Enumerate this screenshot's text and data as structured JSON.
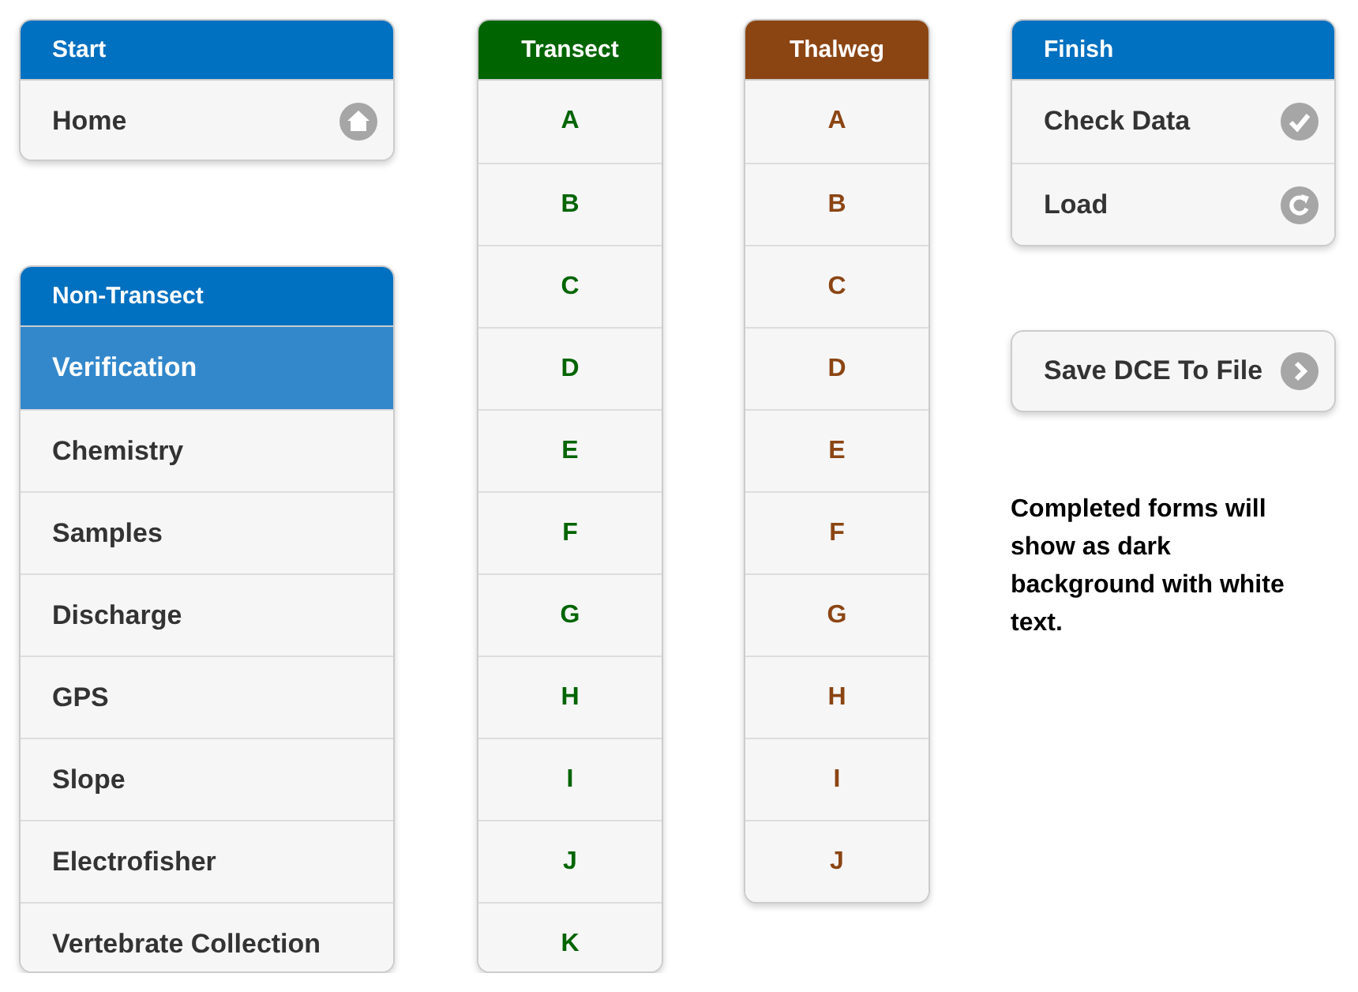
{
  "columns": [
    {
      "panels": [
        {
          "title": "Start",
          "color": "#0070c0",
          "kind": "nav",
          "items": [
            {
              "label": "Home",
              "kind": "home",
              "selected": false
            }
          ]
        },
        {
          "title": "Non-Transect",
          "color": "#0070c0",
          "kind": "nav",
          "items": [
            {
              "label": "Verification",
              "selected": true
            },
            {
              "label": "Chemistry",
              "selected": false
            },
            {
              "label": "Samples",
              "selected": false
            },
            {
              "label": "Discharge",
              "selected": false
            },
            {
              "label": "GPS",
              "selected": false
            },
            {
              "label": "Slope",
              "selected": false
            },
            {
              "label": "Electrofisher",
              "selected": false
            },
            {
              "label": "Vertebrate Collection",
              "selected": false
            }
          ]
        }
      ]
    },
    {
      "panels": [
        {
          "title": "Transect",
          "color": "#006400",
          "kind": "letters",
          "items": [
            {
              "label": "A",
              "selected": false
            },
            {
              "label": "B",
              "selected": false
            },
            {
              "label": "C",
              "selected": false
            },
            {
              "label": "D",
              "selected": false
            },
            {
              "label": "E",
              "selected": false
            },
            {
              "label": "F",
              "selected": false
            },
            {
              "label": "G",
              "selected": false
            },
            {
              "label": "H",
              "selected": false
            },
            {
              "label": "I",
              "selected": false
            },
            {
              "label": "J",
              "selected": false
            },
            {
              "label": "K",
              "selected": false
            }
          ]
        }
      ]
    },
    {
      "panels": [
        {
          "title": "Thalweg",
          "color": "#8b4513",
          "kind": "letters",
          "items": [
            {
              "label": "A",
              "selected": false
            },
            {
              "label": "B",
              "selected": false
            },
            {
              "label": "C",
              "selected": false
            },
            {
              "label": "D",
              "selected": false
            },
            {
              "label": "E",
              "selected": false
            },
            {
              "label": "F",
              "selected": false
            },
            {
              "label": "G",
              "selected": false
            },
            {
              "label": "H",
              "selected": false
            },
            {
              "label": "I",
              "selected": false
            },
            {
              "label": "J",
              "selected": false
            }
          ]
        }
      ]
    },
    {
      "panels": [
        {
          "title": "Finish",
          "color": "#0070c0",
          "kind": "nav",
          "items": [
            {
              "label": "Check Data",
              "kind": "check",
              "selected": false
            },
            {
              "label": "Load",
              "kind": "reload",
              "selected": false
            }
          ]
        }
      ],
      "button": {
        "label": "Save DCE To File",
        "kind": "arrow"
      },
      "note": "Completed forms will show as dark background with white text."
    }
  ]
}
